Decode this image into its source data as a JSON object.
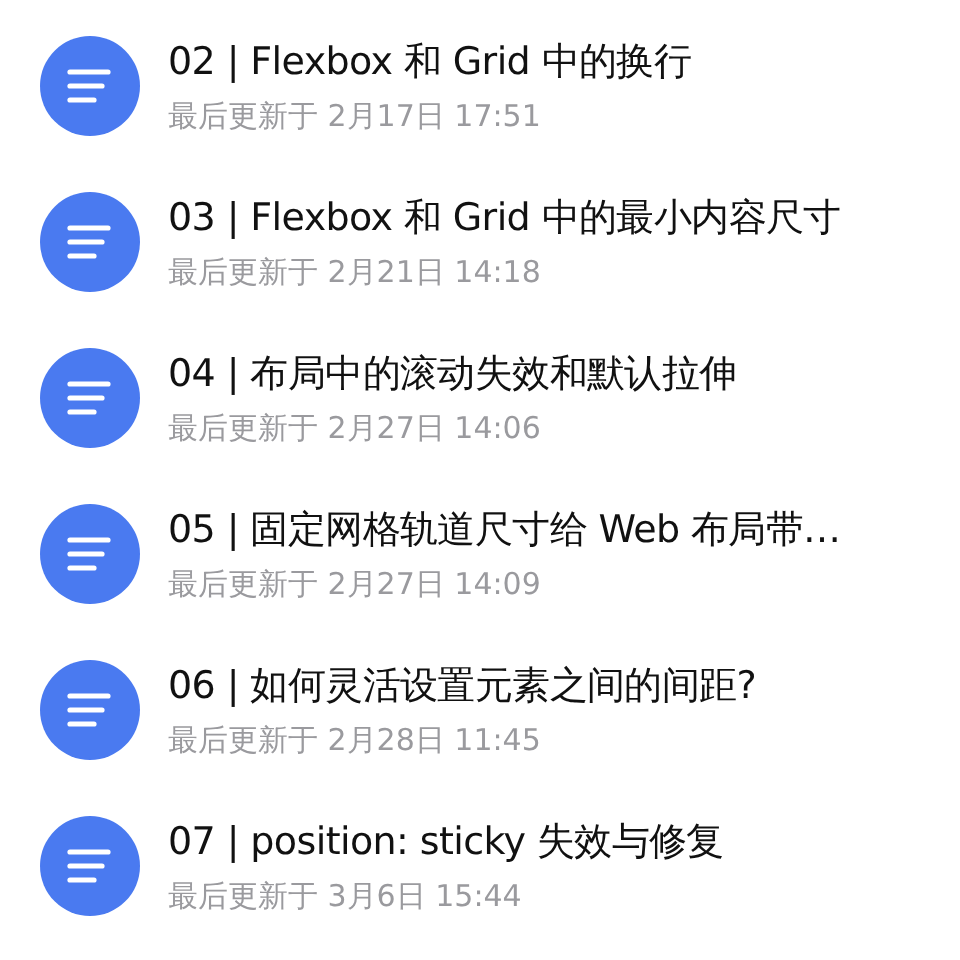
{
  "articles": [
    {
      "title": "02 | Flexbox 和 Grid 中的换行",
      "updated": "最后更新于 2月17日 17:51"
    },
    {
      "title": "03 | Flexbox 和 Grid 中的最小内容尺寸",
      "updated": "最后更新于 2月21日 14:18"
    },
    {
      "title": "04 | 布局中的滚动失效和默认拉伸",
      "updated": "最后更新于 2月27日 14:06"
    },
    {
      "title": "05 | 固定网格轨道尺寸给 Web 布局带…",
      "updated": "最后更新于 2月27日 14:09"
    },
    {
      "title": "06 | 如何灵活设置元素之间的间距?",
      "updated": "最后更新于 2月28日 11:45"
    },
    {
      "title": "07 | position: sticky 失效与修复",
      "updated": "最后更新于 3月6日 15:44"
    }
  ]
}
